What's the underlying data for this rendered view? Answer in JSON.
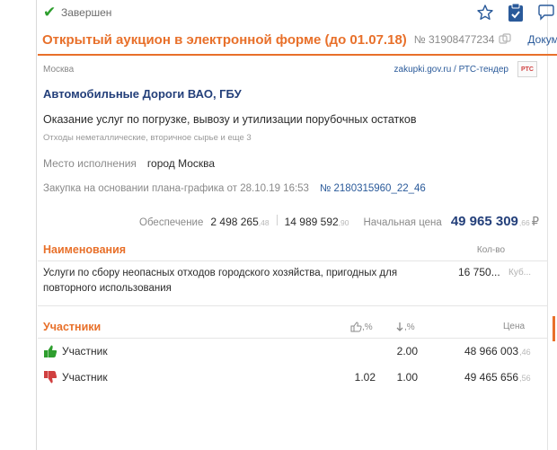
{
  "status": {
    "text": "Завершен"
  },
  "header": {
    "title": "Открытый аукцион в электронной форме (до 01.07.18)",
    "number": "№ 31908477234",
    "docs_label": "Докум"
  },
  "meta": {
    "region": "Москва",
    "platform": "zakupki.gov.ru / РТС-тендер",
    "platform_logo_text": "РТС"
  },
  "customer": "Автомобильные Дороги ВАО, ГБУ",
  "subject": "Оказание услуг по погрузке, вывозу и утилизации порубочных остатков",
  "okpd": "Отходы неметаллические, вторичное сырье и еще 3",
  "place": {
    "label": "Место исполнения",
    "value": "город Москва"
  },
  "plan": {
    "label": "Закупка на основании плана-графика от 28.10.19 16:53",
    "number": "№ 2180315960_22_46"
  },
  "finance": {
    "security_label": "Обеспечение",
    "security_main": "2 498 265",
    "security_kop": ",48",
    "contract_main": "14 989 592",
    "contract_kop": ",90",
    "price_label": "Начальная цена",
    "price_main": "49 965 309",
    "price_kop": ",66",
    "currency": "₽"
  },
  "items": {
    "heading": "Наименования",
    "qty_heading": "Кол-во",
    "rows": [
      {
        "name": "Услуги по сбору неопасных отходов городского хозяйства, пригодных для повторного использования",
        "qty": "16 750...",
        "unit": "Куб..."
      }
    ]
  },
  "participants": {
    "heading": "Участники",
    "col_like": ",%",
    "col_drop": ",%",
    "col_price": "Цена",
    "rows": [
      {
        "name": "Участник",
        "status": "winner",
        "like": "",
        "drop": "2.00",
        "price_main": "48 966 003",
        "price_kop": ",46"
      },
      {
        "name": "Участник",
        "status": "loser",
        "like": "1.02",
        "drop": "1.00",
        "price_main": "49 465 656",
        "price_kop": ",56"
      }
    ]
  },
  "colors": {
    "accent": "#e8702a",
    "link": "#2a5a9a",
    "title_blue": "#233f7a",
    "win": "#2e9e2e",
    "lose": "#d04040"
  },
  "icons": [
    "check-icon",
    "star-icon",
    "clipboard-check-icon",
    "comment-icon",
    "copy-icon",
    "thumb-up-icon",
    "arrow-down-icon",
    "thumb-down-icon"
  ]
}
